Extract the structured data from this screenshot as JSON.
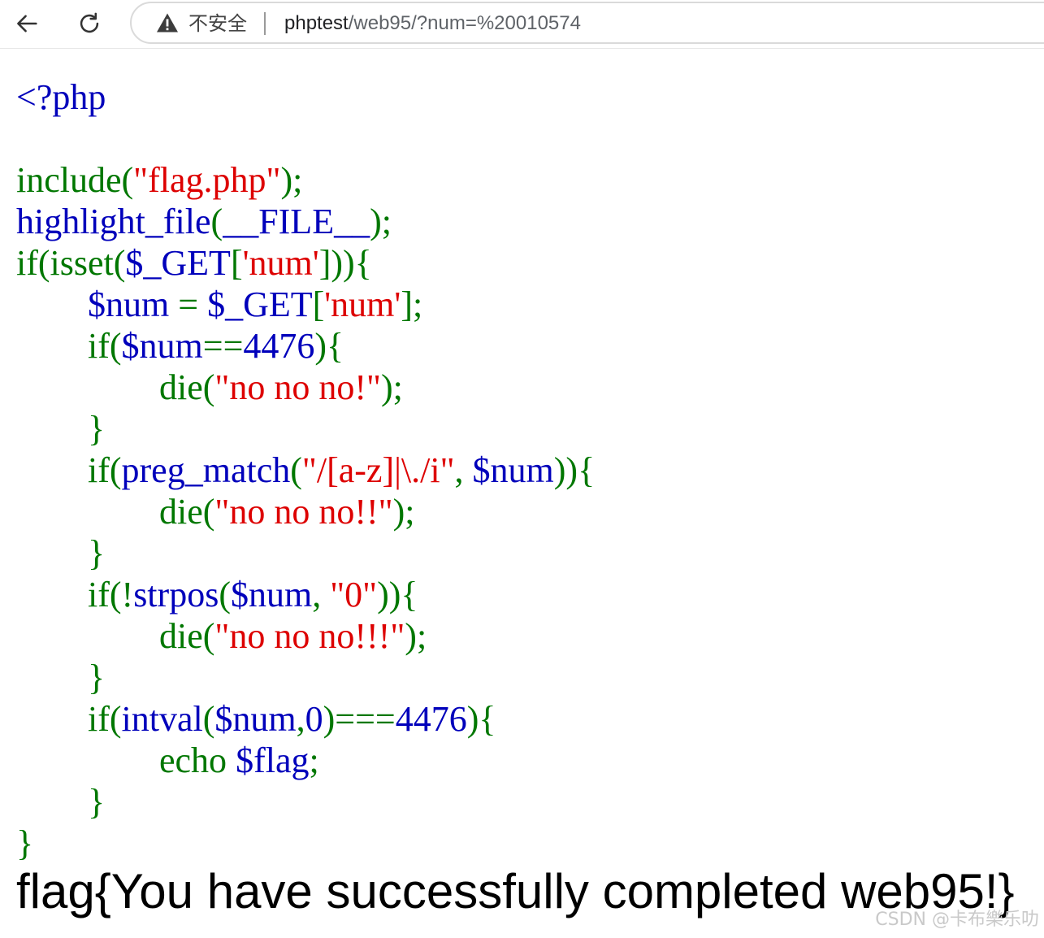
{
  "browser": {
    "security_label": "不安全",
    "url_host": "phptest",
    "url_path": "/web95/?num=%20010574",
    "icons": {
      "back": "arrow-left-icon",
      "reload": "reload-icon",
      "security": "warning-triangle-icon"
    }
  },
  "colors": {
    "keyword": "#007700",
    "identifier": "#0000bb",
    "string": "#dd0000",
    "html": "#0000bb"
  },
  "code": {
    "lines": [
      {
        "indent": "",
        "tokens": [
          {
            "t": "<?php",
            "c": "html"
          }
        ]
      },
      {
        "indent": "",
        "tokens": []
      },
      {
        "indent": "",
        "tokens": [
          {
            "t": "include(",
            "c": "kw"
          },
          {
            "t": "\"flag.php\"",
            "c": "str"
          },
          {
            "t": ");",
            "c": "kw"
          }
        ]
      },
      {
        "indent": "",
        "tokens": [
          {
            "t": "highlight_file",
            "c": "id"
          },
          {
            "t": "(",
            "c": "kw"
          },
          {
            "t": "__FILE__",
            "c": "id"
          },
          {
            "t": ");",
            "c": "kw"
          }
        ]
      },
      {
        "indent": "",
        "tokens": [
          {
            "t": "if(isset(",
            "c": "kw"
          },
          {
            "t": "$_GET",
            "c": "id"
          },
          {
            "t": "[",
            "c": "kw"
          },
          {
            "t": "'num'",
            "c": "str"
          },
          {
            "t": "])){",
            "c": "kw"
          }
        ]
      },
      {
        "indent": "        ",
        "tokens": [
          {
            "t": "$num ",
            "c": "id"
          },
          {
            "t": "= ",
            "c": "kw"
          },
          {
            "t": "$_GET",
            "c": "id"
          },
          {
            "t": "[",
            "c": "kw"
          },
          {
            "t": "'num'",
            "c": "str"
          },
          {
            "t": "];",
            "c": "kw"
          }
        ]
      },
      {
        "indent": "        ",
        "tokens": [
          {
            "t": "if(",
            "c": "kw"
          },
          {
            "t": "$num",
            "c": "id"
          },
          {
            "t": "==",
            "c": "kw"
          },
          {
            "t": "4476",
            "c": "id"
          },
          {
            "t": "){",
            "c": "kw"
          }
        ]
      },
      {
        "indent": "                ",
        "tokens": [
          {
            "t": "die(",
            "c": "kw"
          },
          {
            "t": "\"no no no!\"",
            "c": "str"
          },
          {
            "t": ");",
            "c": "kw"
          }
        ]
      },
      {
        "indent": "        ",
        "tokens": [
          {
            "t": "}",
            "c": "kw"
          }
        ]
      },
      {
        "indent": "        ",
        "tokens": [
          {
            "t": "if(",
            "c": "kw"
          },
          {
            "t": "preg_match",
            "c": "id"
          },
          {
            "t": "(",
            "c": "kw"
          },
          {
            "t": "\"/[a-z]|\\./i\"",
            "c": "str"
          },
          {
            "t": ", ",
            "c": "kw"
          },
          {
            "t": "$num",
            "c": "id"
          },
          {
            "t": ")){",
            "c": "kw"
          }
        ]
      },
      {
        "indent": "                ",
        "tokens": [
          {
            "t": "die(",
            "c": "kw"
          },
          {
            "t": "\"no no no!!\"",
            "c": "str"
          },
          {
            "t": ");",
            "c": "kw"
          }
        ]
      },
      {
        "indent": "        ",
        "tokens": [
          {
            "t": "}",
            "c": "kw"
          }
        ]
      },
      {
        "indent": "        ",
        "tokens": [
          {
            "t": "if(!",
            "c": "kw"
          },
          {
            "t": "strpos",
            "c": "id"
          },
          {
            "t": "(",
            "c": "kw"
          },
          {
            "t": "$num",
            "c": "id"
          },
          {
            "t": ", ",
            "c": "kw"
          },
          {
            "t": "\"0\"",
            "c": "str"
          },
          {
            "t": ")){",
            "c": "kw"
          }
        ]
      },
      {
        "indent": "                ",
        "tokens": [
          {
            "t": "die(",
            "c": "kw"
          },
          {
            "t": "\"no no no!!!\"",
            "c": "str"
          },
          {
            "t": ");",
            "c": "kw"
          }
        ]
      },
      {
        "indent": "        ",
        "tokens": [
          {
            "t": "}",
            "c": "kw"
          }
        ]
      },
      {
        "indent": "        ",
        "tokens": [
          {
            "t": "if(",
            "c": "kw"
          },
          {
            "t": "intval",
            "c": "id"
          },
          {
            "t": "(",
            "c": "kw"
          },
          {
            "t": "$num",
            "c": "id"
          },
          {
            "t": ",",
            "c": "kw"
          },
          {
            "t": "0",
            "c": "id"
          },
          {
            "t": ")===",
            "c": "kw"
          },
          {
            "t": "4476",
            "c": "id"
          },
          {
            "t": "){",
            "c": "kw"
          }
        ]
      },
      {
        "indent": "                ",
        "tokens": [
          {
            "t": "echo ",
            "c": "kw"
          },
          {
            "t": "$flag",
            "c": "id"
          },
          {
            "t": ";",
            "c": "kw"
          }
        ]
      },
      {
        "indent": "        ",
        "tokens": [
          {
            "t": "}",
            "c": "kw"
          }
        ]
      },
      {
        "indent": "",
        "tokens": [
          {
            "t": "}",
            "c": "kw"
          }
        ]
      }
    ]
  },
  "output": {
    "flag_text": "flag{You have successfully completed web95!}"
  },
  "watermark": "CSDN @卡布樂乐叻"
}
